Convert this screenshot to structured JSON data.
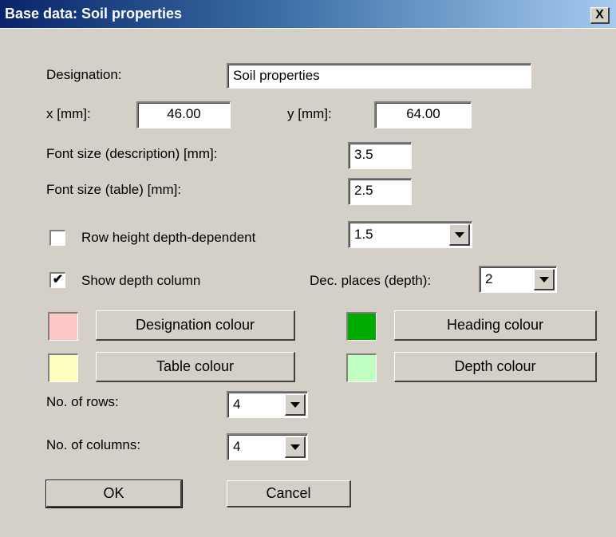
{
  "window": {
    "title": "Base data: Soil properties",
    "close_glyph": "X"
  },
  "designation": {
    "label": "Designation:",
    "value": "Soil properties"
  },
  "x": {
    "label": "x [mm]:",
    "value": "46.00"
  },
  "y": {
    "label": "y [mm]:",
    "value": "64.00"
  },
  "font_desc": {
    "label": "Font size (description) [mm]:",
    "value": "3.5"
  },
  "font_table": {
    "label": "Font size (table) [mm]:",
    "value": "2.5"
  },
  "row_height": {
    "label": "Row height depth-dependent",
    "checked": false,
    "mark": "",
    "value": "1.5"
  },
  "depth_column": {
    "label": "Show depth column",
    "checked": true,
    "mark": "✔"
  },
  "dec_places": {
    "label": "Dec. places (depth):",
    "value": "2"
  },
  "colors": {
    "designation": {
      "label": "Designation colour",
      "swatch": "#ffc8c8"
    },
    "heading": {
      "label": "Heading colour",
      "swatch": "#00aa00"
    },
    "table": {
      "label": "Table colour",
      "swatch": "#ffffc0"
    },
    "depth": {
      "label": "Depth colour",
      "swatch": "#c0ffc0"
    }
  },
  "rows": {
    "label": "No. of rows:",
    "value": "4"
  },
  "columns": {
    "label": "No. of columns:",
    "value": "4"
  },
  "buttons": {
    "ok": "OK",
    "cancel": "Cancel"
  }
}
